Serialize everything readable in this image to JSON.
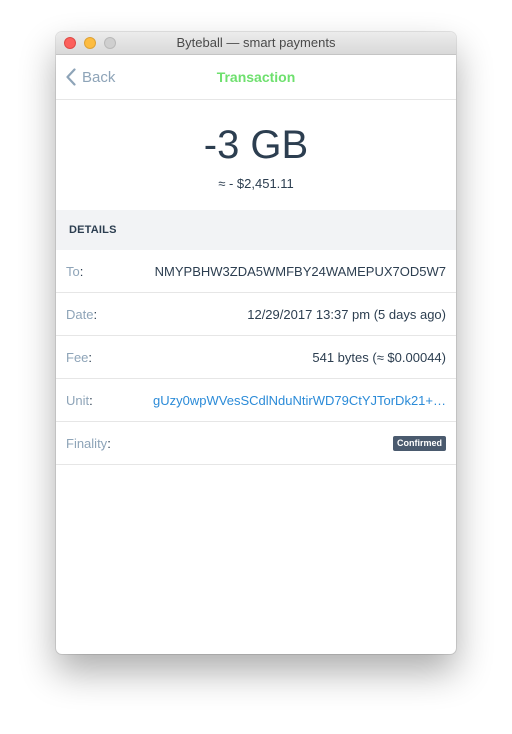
{
  "window": {
    "title": "Byteball — smart payments"
  },
  "nav": {
    "back_label": "Back",
    "title": "Transaction"
  },
  "transaction": {
    "amount": "-3 GB",
    "fiat": "≈ - $2,451.11"
  },
  "details": {
    "header": "DETAILS",
    "rows": [
      {
        "label": "To",
        "value": "NMYPBHW3ZDA5WMFBY24WAMEPUX7OD5W7"
      },
      {
        "label": "Date",
        "value": "12/29/2017 13:37 pm (5 days ago)"
      },
      {
        "label": "Fee",
        "value": "541 bytes (≈ $0.00044)"
      },
      {
        "label": "Unit",
        "value": "gUzy0wpWVesSCdlNduNtirWD79CtYJTorDk21+…"
      },
      {
        "label": "Finality",
        "value": "Confirmed"
      }
    ]
  },
  "colors": {
    "accent_green": "#6ee06e",
    "label_blue_gray": "#8ea4b8",
    "link_blue": "#2b8bd8",
    "badge_bg": "#4a5a6e",
    "text_dark": "#2c3e50"
  },
  "icons": {
    "back": "chevron-left-icon"
  }
}
